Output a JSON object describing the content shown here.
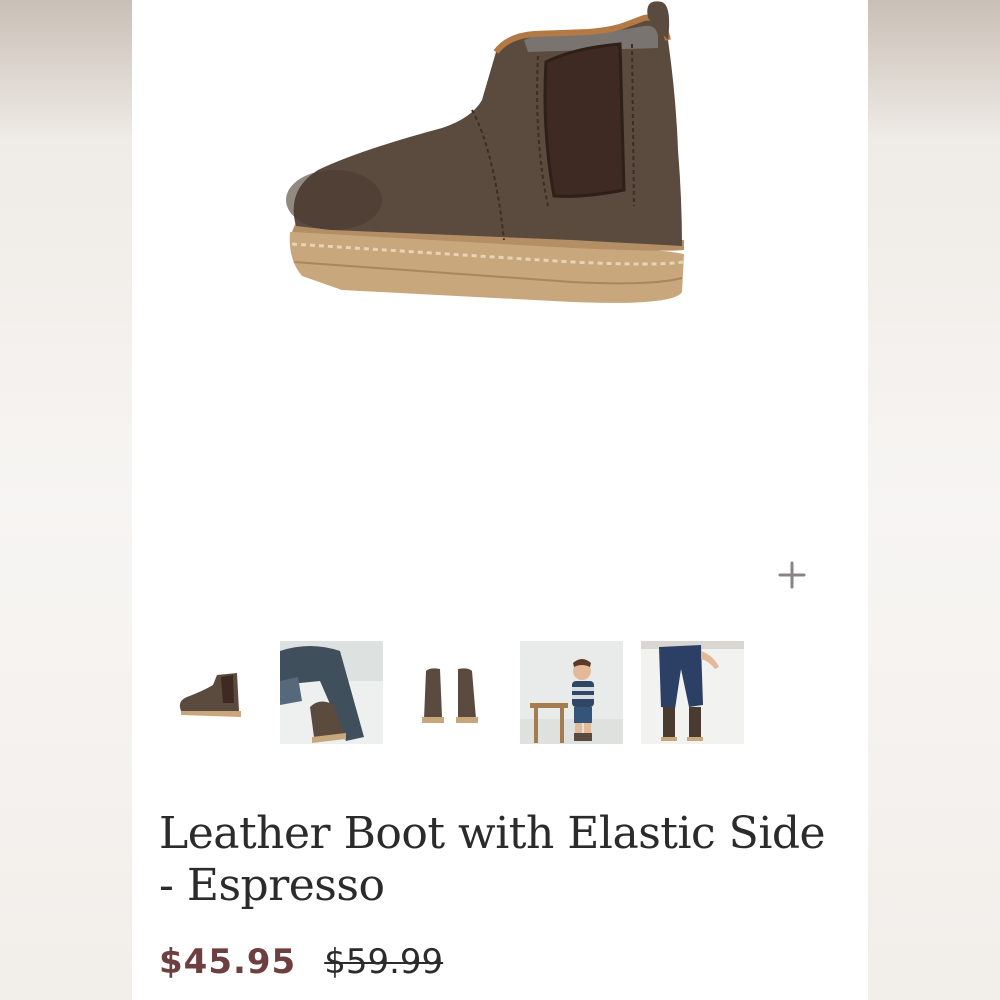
{
  "product": {
    "title": "Leather Boot with Elastic Side - Espresso",
    "price_sale": "$45.95",
    "price_original": "$59.99"
  },
  "gallery": {
    "zoom_icon": "plus-icon",
    "selected_index": 0,
    "thumbnails": [
      {
        "subject": "boot-side-view"
      },
      {
        "subject": "child-wearing-boots-closeup"
      },
      {
        "subject": "boot-pair-front-view"
      },
      {
        "subject": "toddler-standing-by-stool"
      },
      {
        "subject": "child-jeans-and-boots"
      }
    ]
  },
  "colors": {
    "sale_price": "#6e3f40",
    "text": "#2b2b2b",
    "leather": "#5b4a3e",
    "sole": "#c9a77d"
  }
}
